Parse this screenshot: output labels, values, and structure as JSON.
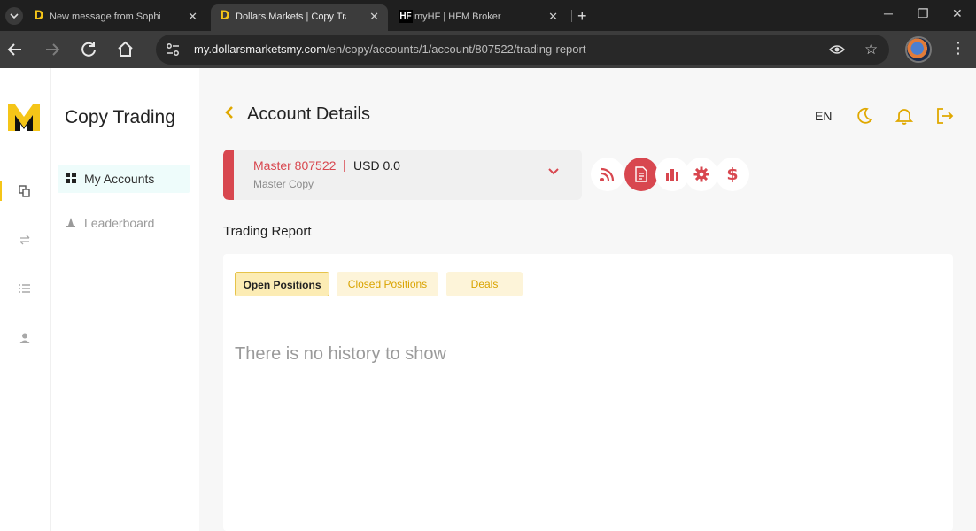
{
  "browser": {
    "tabs": [
      {
        "title": "New message from Sophia F",
        "favicon": "D"
      },
      {
        "title": "Dollars Markets | Copy Tradin",
        "favicon": "D",
        "active": true
      },
      {
        "title": "myHF | HFM Broker",
        "favicon": "HF"
      }
    ],
    "url_domain": "my.dollarsmarketsmy.com",
    "url_path": "/en/copy/accounts/1/account/807522/trading-report"
  },
  "sidebar": {
    "brand": "Copy Trading",
    "items": [
      {
        "label": "My Accounts",
        "icon": "grid-icon",
        "active": true
      },
      {
        "label": "Leaderboard",
        "icon": "podium-icon",
        "active": false
      }
    ]
  },
  "header": {
    "title": "Account Details",
    "lang": "EN"
  },
  "account": {
    "name": "Master 807522",
    "separator": "|",
    "balance": "USD 0.0",
    "type": "Master Copy"
  },
  "actions": [
    "rss-icon",
    "report-icon",
    "chart-icon",
    "settings-icon",
    "dollar-icon"
  ],
  "report": {
    "title": "Trading Report",
    "tabs": [
      "Open Positions",
      "Closed Positions",
      "Deals"
    ],
    "empty": "There is no history to show"
  },
  "colors": {
    "accent": "#f5c518",
    "brand_red": "#d8474f"
  }
}
